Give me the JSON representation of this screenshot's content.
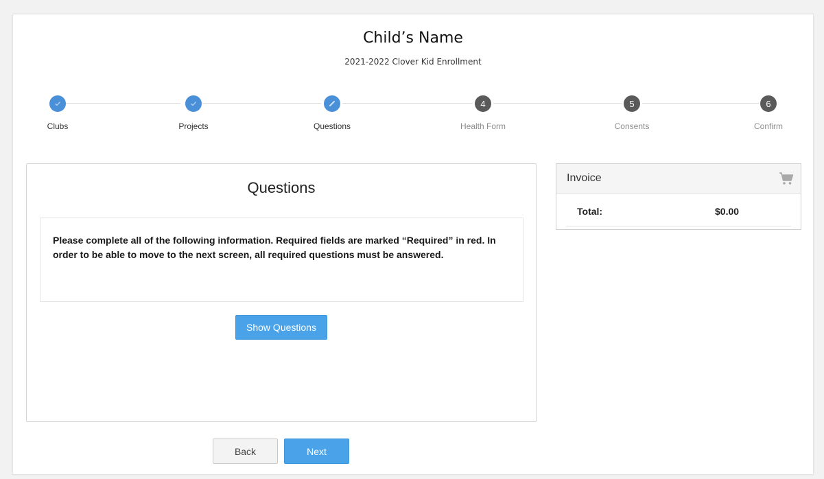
{
  "header": {
    "child_name": "Child’s Name",
    "subtitle": "2021-2022 Clover Kid Enrollment"
  },
  "stepper": {
    "steps": [
      {
        "label": "Clubs",
        "status": "done",
        "icon": "check-icon"
      },
      {
        "label": "Projects",
        "status": "done",
        "icon": "check-icon"
      },
      {
        "label": "Questions",
        "status": "current",
        "icon": "pencil-icon"
      },
      {
        "label": "Health Form",
        "status": "pending",
        "number": "4"
      },
      {
        "label": "Consents",
        "status": "pending",
        "number": "5"
      },
      {
        "label": "Confirm",
        "status": "pending",
        "number": "6"
      }
    ]
  },
  "questions": {
    "title": "Questions",
    "instructions": "Please complete all of the following information.  Required fields are marked “Required” in red.  In order to be able to move to the next screen, all required questions must be answered.",
    "show_button_label": "Show Questions"
  },
  "invoice": {
    "title": "Invoice",
    "icon": "shopping-cart-icon",
    "total_label": "Total:",
    "total_value": "$0.00"
  },
  "footer": {
    "back_label": "Back",
    "next_label": "Next"
  },
  "colors": {
    "accent": "#4aa3e8",
    "step_done": "#4a90d9",
    "step_pending": "#5a5a5a",
    "background": "#f2f2f2"
  }
}
